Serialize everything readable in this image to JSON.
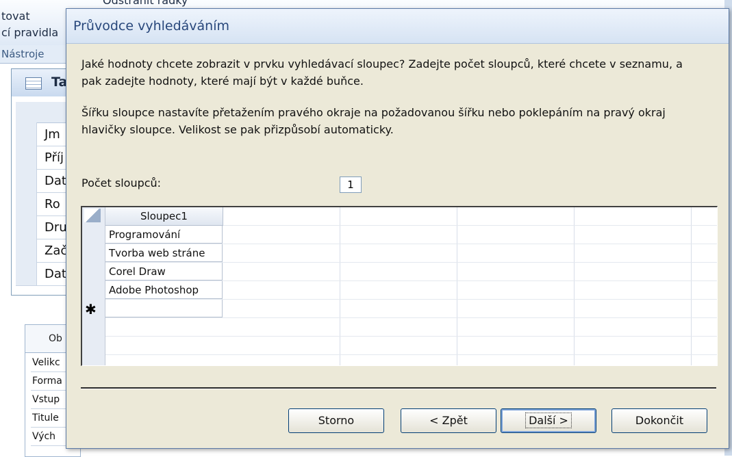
{
  "background": {
    "ribbon_texts": [
      "tovat",
      "cí pravidla",
      "Odstranit řádky"
    ],
    "ribbon_label": "Nástroje",
    "table_tab_title": "Ta",
    "table_rows": [
      "Jm",
      "Příj",
      "Dat",
      "Ro",
      "Dru",
      "Zač",
      "Dat"
    ],
    "lower_tab": "Ob",
    "property_rows": [
      "Velikc",
      "Forma",
      "Vstup",
      "Titule",
      "Vých"
    ]
  },
  "dialog": {
    "title": "Průvodce vyhledáváním",
    "instruction_1": "Jaké hodnoty chcete zobrazit v prvku vyhledávací sloupec? Zadejte počet sloupců, které chcete v seznamu, a pak zadejte hodnoty, které mají být v každé buňce.",
    "instruction_2": "Šířku sloupce nastavíte přetažením pravého okraje na požadovanou šířku nebo poklepáním na pravý okraj hlavičky sloupce. Velikost se pak přizpůsobí automaticky.",
    "column_count_label": "Počet sloupců:",
    "column_count_value": "1",
    "grid": {
      "column_header": "Sloupec1",
      "rows": [
        "Programování",
        "Tvorba web stráne",
        "Corel Draw",
        "Adobe Photoshop"
      ],
      "new_row_marker": "✱"
    },
    "buttons": {
      "cancel": "Storno",
      "back": "< Zpět",
      "next": "Další >",
      "finish": "Dokončit"
    }
  }
}
